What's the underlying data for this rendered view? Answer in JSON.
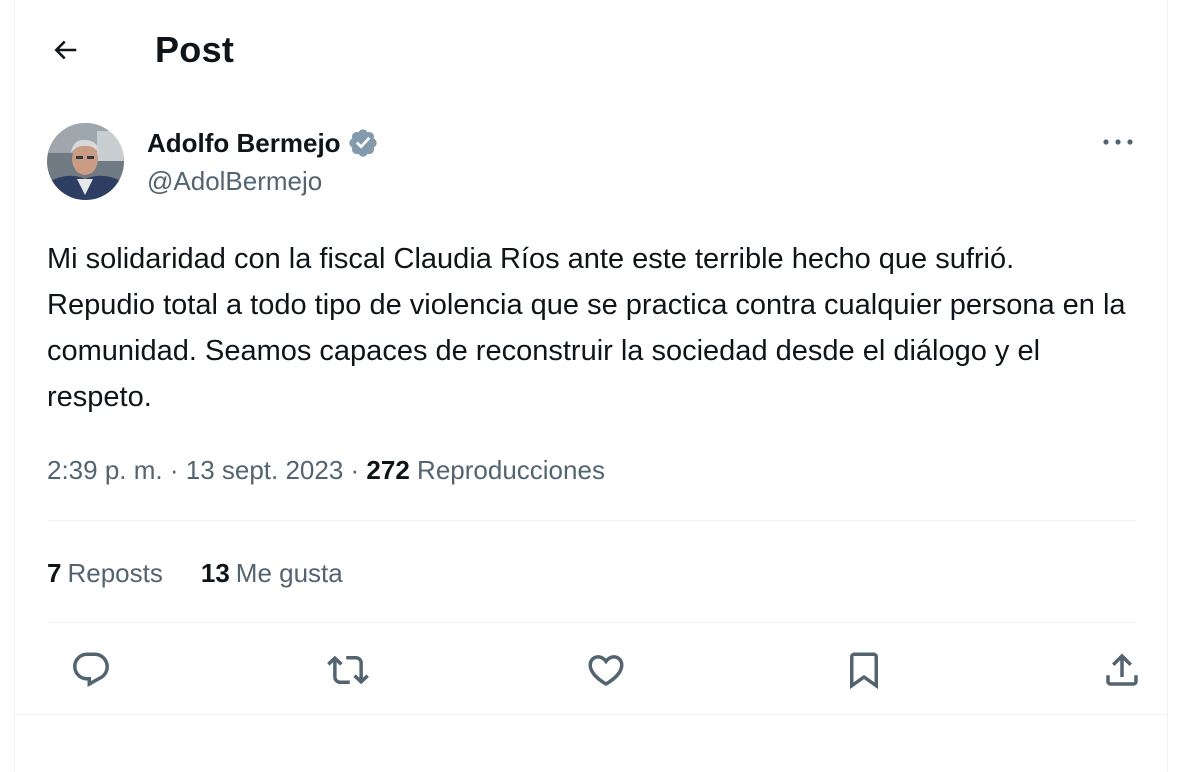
{
  "header": {
    "title": "Post",
    "back_icon": "arrow-left-icon"
  },
  "author": {
    "name": "Adolfo Bermejo",
    "handle": "@AdolBermejo",
    "verified": true,
    "verified_color": "#829aab",
    "avatar_icon": "avatar-photo"
  },
  "tweet": {
    "text": "Mi solidaridad con la fiscal Claudia Ríos ante este terrible hecho que sufrió. Repudio total a todo tipo de violencia que se practica contra cualquier persona en la comunidad. Seamos capaces de reconstruir la sociedad desde el diálogo y el respeto.",
    "time": "2:39 p. m.",
    "sep1": " · ",
    "date": "13 sept. 2023",
    "sep2": " · ",
    "views_count": "272",
    "views_label": "Reproducciones"
  },
  "stats": {
    "reposts_count": "7",
    "reposts_label": "Reposts",
    "likes_count": "13",
    "likes_label": "Me gusta"
  },
  "actions": [
    {
      "icon": "reply-icon"
    },
    {
      "icon": "repost-icon"
    },
    {
      "icon": "like-icon"
    },
    {
      "icon": "bookmark-icon"
    },
    {
      "icon": "share-icon"
    }
  ],
  "colors": {
    "text_primary": "#0f1419",
    "text_secondary": "#536471",
    "divider": "#eff3f4"
  }
}
